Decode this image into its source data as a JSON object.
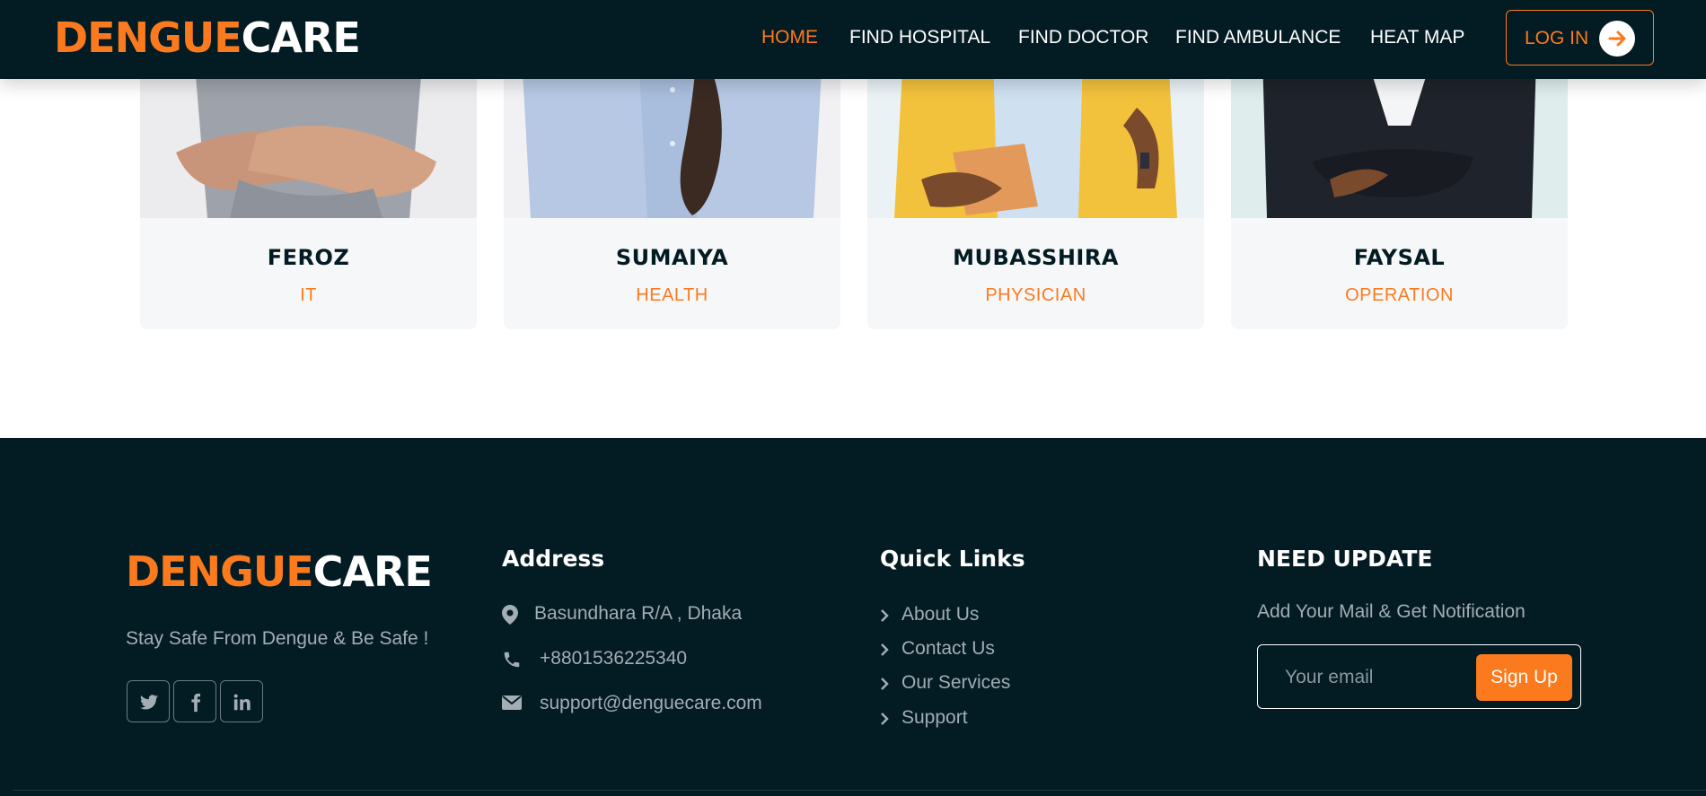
{
  "brand": {
    "part1": "DENGUE",
    "part2": "CARE"
  },
  "nav": {
    "items": [
      {
        "label": "HOME",
        "active": true
      },
      {
        "label": "FIND HOSPITAL",
        "active": false
      },
      {
        "label": "FIND DOCTOR",
        "active": false
      },
      {
        "label": "FIND AMBULANCE",
        "active": false
      },
      {
        "label": "HEAT MAP",
        "active": false
      }
    ],
    "login_label": "LOG IN"
  },
  "team": [
    {
      "name": "FEROZ",
      "role": "IT"
    },
    {
      "name": "SUMAIYA",
      "role": "HEALTH"
    },
    {
      "name": "MUBASSHIRA",
      "role": "PHYSICIAN"
    },
    {
      "name": "FAYSAL",
      "role": "OPERATION"
    }
  ],
  "footer": {
    "tagline": "Stay Safe From Dengue & Be Safe !",
    "social_icons": [
      "twitter-icon",
      "facebook-icon",
      "linkedin-icon"
    ],
    "address": {
      "title": "Address",
      "location": "Basundhara R/A , Dhaka",
      "phone": "+8801536225340",
      "email": "support@denguecare.com"
    },
    "quick_links": {
      "title": "Quick Links",
      "items": [
        "About Us",
        "Contact Us",
        "Our Services",
        "Support"
      ]
    },
    "newsletter": {
      "title": "NEED UPDATE",
      "text": "Add Your Mail & Get Notification",
      "placeholder": "Your email",
      "button": "Sign Up"
    }
  },
  "colors": {
    "accent": "#fc7a1e",
    "dark": "#031b23",
    "card_bg": "#f6f7f9",
    "muted_text": "#a2adb4"
  }
}
